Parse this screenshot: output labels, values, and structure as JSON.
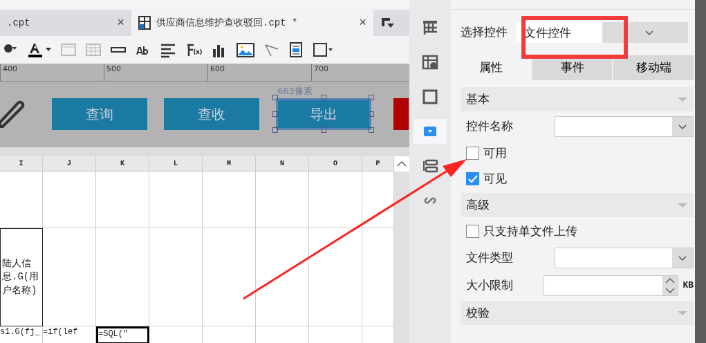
{
  "file_tabs": [
    {
      "label": ".cpt",
      "close": "×",
      "selected": false
    },
    {
      "label": "供应商信息维护查收驳回.cpt *",
      "close": "×",
      "selected": true
    }
  ],
  "ruler": {
    "ticks": [
      "400",
      "500",
      "600",
      "700"
    ]
  },
  "canvas": {
    "size_label": "663像素",
    "buttons": [
      {
        "label": "查询",
        "selected": false
      },
      {
        "label": "查收",
        "selected": false
      },
      {
        "label": "导出",
        "selected": true
      }
    ]
  },
  "sheet": {
    "columns": [
      "I",
      "J",
      "K",
      "L",
      "M",
      "N",
      "O",
      "P"
    ],
    "rows": [
      [
        {
          "selected": false
        },
        {
          "selected": false
        },
        {
          "selected": false
        },
        {
          "selected": false
        },
        {
          "selected": false
        },
        {
          "selected": false
        },
        {
          "selected": false
        },
        {
          "selected": false
        }
      ],
      [
        {
          "text": "陆人信息.G(用户名称)",
          "selected": false
        },
        {
          "selected": false
        },
        {
          "selected": false
        },
        {
          "selected": false
        },
        {
          "selected": false
        },
        {
          "selected": false
        },
        {
          "selected": false
        },
        {
          "selected": false
        }
      ],
      [
        {
          "text": "s1.G(fj_",
          "selected": false
        },
        {
          "text": "=if(lef",
          "selected": false
        },
        {
          "text": "=SQL(\"",
          "selected": true
        },
        {
          "selected": false
        },
        {
          "selected": false
        },
        {
          "selected": false
        },
        {
          "selected": false
        },
        {
          "selected": false
        }
      ]
    ]
  },
  "side_icons": [
    {
      "selected": false
    },
    {
      "selected": false
    },
    {
      "selected": false
    },
    {
      "selected": true
    },
    {
      "selected": false
    },
    {
      "selected": false
    }
  ],
  "panel": {
    "select_label": "选择控件",
    "select_value": "文件控件",
    "tabs": [
      {
        "label": "属性",
        "selected": true
      },
      {
        "label": "事件",
        "selected": false
      },
      {
        "label": "移动端",
        "selected": false
      }
    ],
    "items": [
      {
        "kind": "section",
        "label": "基本"
      },
      {
        "kind": "combo",
        "label": "控件名称"
      },
      {
        "kind": "check",
        "label": "可用",
        "checked": false
      },
      {
        "kind": "check",
        "label": "可见",
        "checked": true
      },
      {
        "kind": "section",
        "label": "高级"
      },
      {
        "kind": "check",
        "label": "只支持单文件上传",
        "checked": false
      },
      {
        "kind": "combo",
        "label": "文件类型"
      },
      {
        "kind": "spinner",
        "label": "大小限制",
        "unit": "KB"
      },
      {
        "kind": "section",
        "label": "校验"
      }
    ]
  }
}
